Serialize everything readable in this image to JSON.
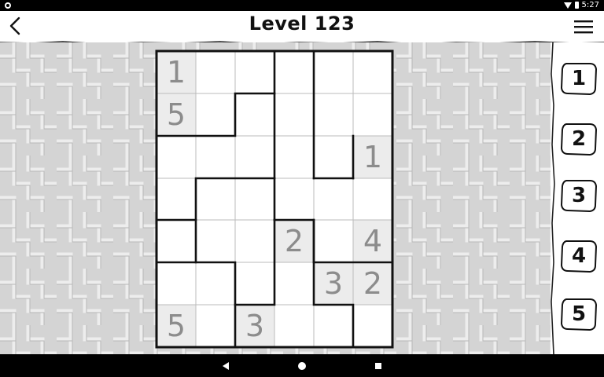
{
  "status_bar": {
    "time": "5:27"
  },
  "header": {
    "title": "Level 123",
    "back_icon": "chevron-left-icon",
    "menu_icon": "hamburger-menu-icon"
  },
  "puzzle": {
    "rows": 7,
    "cols": 6,
    "cells": [
      [
        "1",
        "",
        "",
        "",
        "",
        ""
      ],
      [
        "5",
        "",
        "",
        "",
        "",
        ""
      ],
      [
        "",
        "",
        "",
        "",
        "",
        "1"
      ],
      [
        "",
        "",
        "",
        "",
        "",
        ""
      ],
      [
        "",
        "",
        "",
        "2",
        "",
        "4"
      ],
      [
        "",
        "",
        "",
        "",
        "3",
        "2"
      ],
      [
        "5",
        "",
        "3",
        "",
        "",
        ""
      ]
    ]
  },
  "number_pad": [
    "1",
    "2",
    "3",
    "4",
    "5"
  ],
  "nav_bar": {
    "icons": [
      "back-triangle-icon",
      "home-circle-icon",
      "recents-square-icon"
    ]
  },
  "colors": {
    "given_cell_bg": "#ececec",
    "given_digit": "#8c8c8c",
    "background_maze": "#d4d4d4"
  }
}
